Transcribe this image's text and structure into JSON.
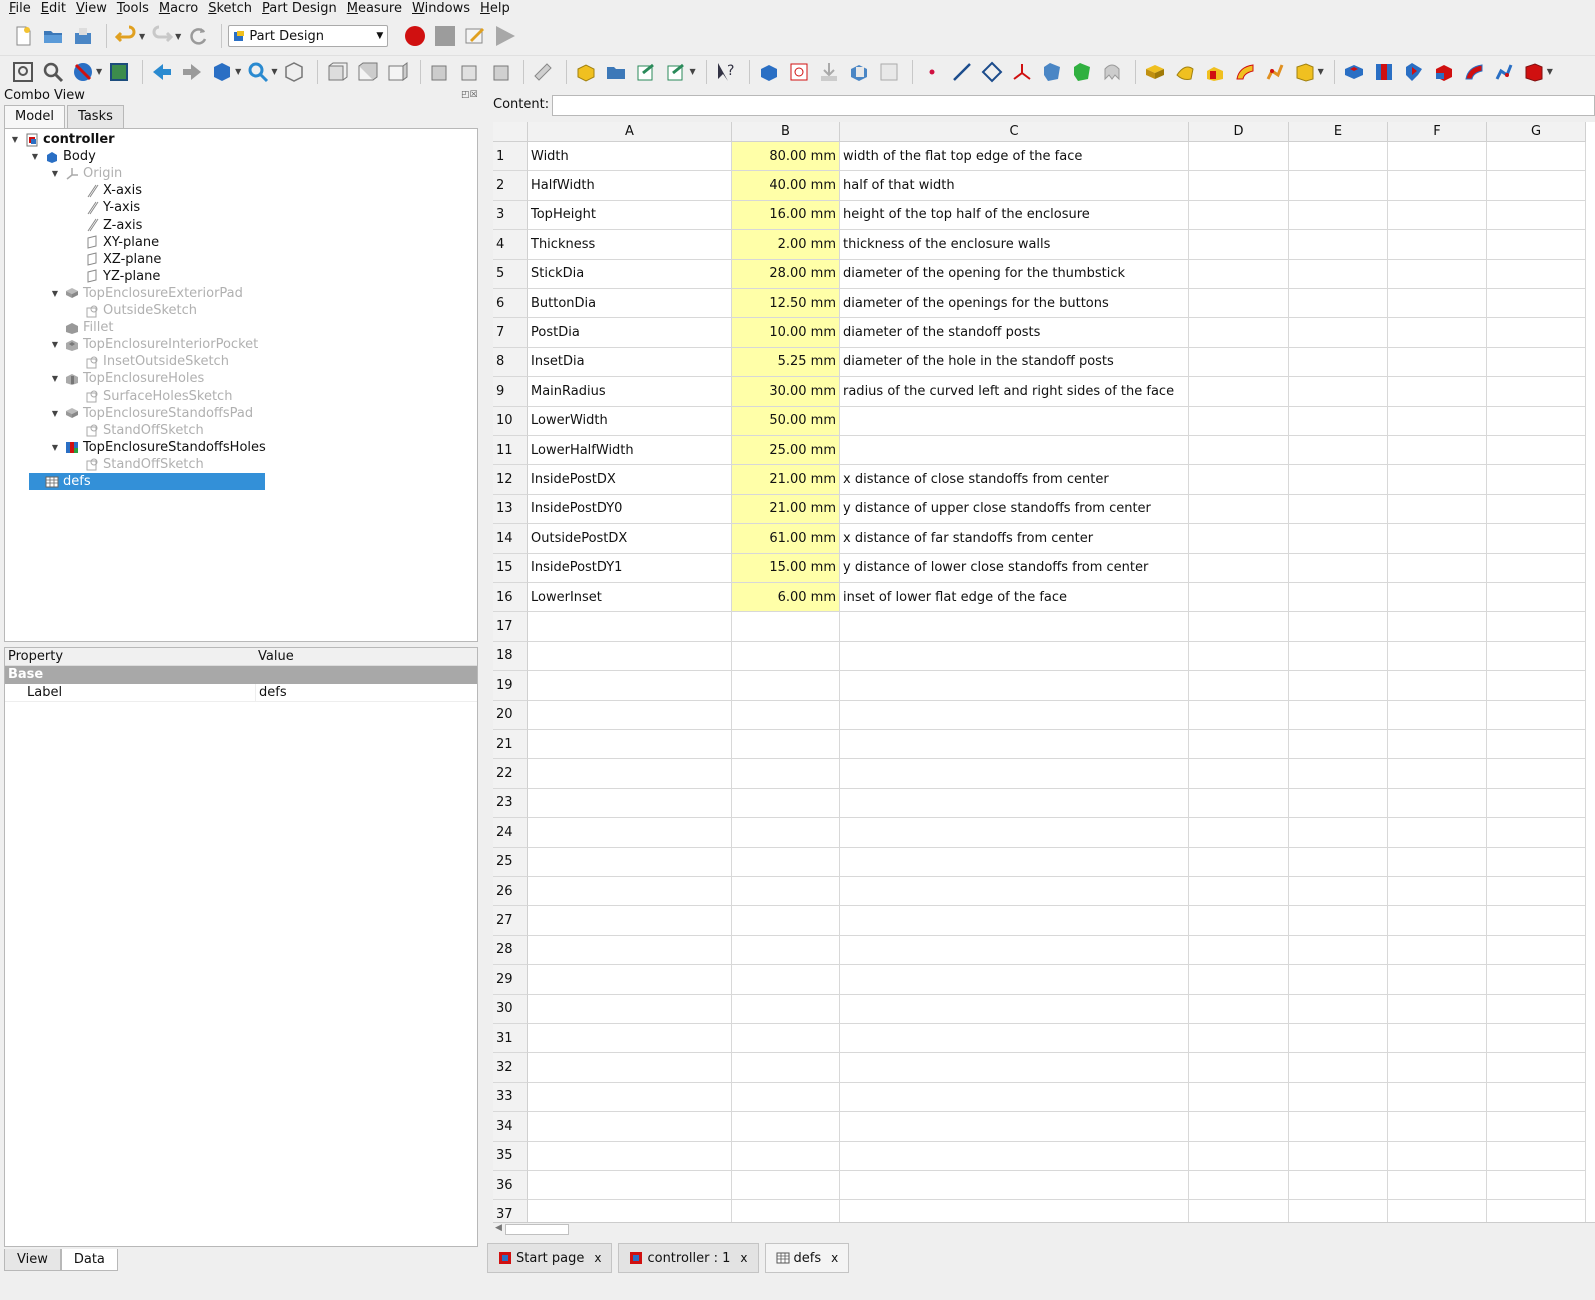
{
  "menu": [
    "File",
    "Edit",
    "View",
    "Tools",
    "Macro",
    "Sketch",
    "Part Design",
    "Measure",
    "Windows",
    "Help"
  ],
  "workbench": "Part Design",
  "combo": {
    "title": "Combo View",
    "tabs": [
      "Model",
      "Tasks"
    ]
  },
  "tree": [
    {
      "label": "controller",
      "level": 0,
      "exp": "▼",
      "style": "bold",
      "icon": "document-icon"
    },
    {
      "label": "Body",
      "level": 1,
      "exp": "▼",
      "style": "",
      "icon": "body-icon"
    },
    {
      "label": "Origin",
      "level": 2,
      "exp": "▼",
      "style": "dim",
      "icon": "origin-icon"
    },
    {
      "label": "X-axis",
      "level": 3,
      "exp": "",
      "style": "",
      "icon": "axis-icon"
    },
    {
      "label": "Y-axis",
      "level": 3,
      "exp": "",
      "style": "",
      "icon": "axis-icon"
    },
    {
      "label": "Z-axis",
      "level": 3,
      "exp": "",
      "style": "",
      "icon": "axis-icon"
    },
    {
      "label": "XY-plane",
      "level": 3,
      "exp": "",
      "style": "",
      "icon": "plane-icon"
    },
    {
      "label": "XZ-plane",
      "level": 3,
      "exp": "",
      "style": "",
      "icon": "plane-icon"
    },
    {
      "label": "YZ-plane",
      "level": 3,
      "exp": "",
      "style": "",
      "icon": "plane-icon"
    },
    {
      "label": "TopEnclosureExteriorPad",
      "level": 2,
      "exp": "▼",
      "style": "dim",
      "icon": "pad-icon"
    },
    {
      "label": "OutsideSketch",
      "level": 3,
      "exp": "",
      "style": "dim",
      "icon": "sketch-icon"
    },
    {
      "label": "Fillet",
      "level": 2,
      "exp": "",
      "style": "dim",
      "icon": "fillet-icon"
    },
    {
      "label": "TopEnclosureInteriorPocket",
      "level": 2,
      "exp": "▼",
      "style": "dim",
      "icon": "pocket-icon"
    },
    {
      "label": "InsetOutsideSketch",
      "level": 3,
      "exp": "",
      "style": "dim",
      "icon": "sketch-icon"
    },
    {
      "label": "TopEnclosureHoles",
      "level": 2,
      "exp": "▼",
      "style": "dim",
      "icon": "hole-icon"
    },
    {
      "label": "SurfaceHolesSketch",
      "level": 3,
      "exp": "",
      "style": "dim",
      "icon": "sketch-icon"
    },
    {
      "label": "TopEnclosureStandoffsPad",
      "level": 2,
      "exp": "▼",
      "style": "dim",
      "icon": "pad-icon"
    },
    {
      "label": "StandOffSketch",
      "level": 3,
      "exp": "",
      "style": "dim",
      "icon": "sketch-icon"
    },
    {
      "label": "TopEnclosureStandoffsHoles",
      "level": 2,
      "exp": "▼",
      "style": "",
      "icon": "hole-active-icon"
    },
    {
      "label": "StandOffSketch",
      "level": 3,
      "exp": "",
      "style": "dim",
      "icon": "sketch-icon"
    },
    {
      "label": "defs",
      "level": 1,
      "exp": "",
      "style": "selected",
      "icon": "spreadsheet-icon"
    }
  ],
  "properties": {
    "headers": [
      "Property",
      "Value"
    ],
    "group": "Base",
    "rows": [
      {
        "name": "Label",
        "value": "defs"
      }
    ]
  },
  "bottom_tabs": [
    "View",
    "Data"
  ],
  "content_label": "Content:",
  "columns": [
    "A",
    "B",
    "C",
    "D",
    "E",
    "F",
    "G"
  ],
  "rows": [
    [
      "Width",
      "80.00 mm",
      "width of the flat top edge of the face"
    ],
    [
      "HalfWidth",
      "40.00 mm",
      "half of that width"
    ],
    [
      "TopHeight",
      "16.00 mm",
      "height of the top half of the enclosure"
    ],
    [
      "Thickness",
      "2.00 mm",
      "thickness of the enclosure walls"
    ],
    [
      "StickDia",
      "28.00 mm",
      "diameter of the opening for the thumbstick"
    ],
    [
      "ButtonDia",
      "12.50 mm",
      "diameter of the openings for the buttons"
    ],
    [
      "PostDia",
      "10.00 mm",
      "diameter of the standoff posts"
    ],
    [
      "InsetDia",
      "5.25 mm",
      "diameter of the hole in the standoff posts"
    ],
    [
      "MainRadius",
      "30.00 mm",
      "radius of the curved left and right sides of the face"
    ],
    [
      "LowerWidth",
      "50.00 mm",
      ""
    ],
    [
      "LowerHalfWidth",
      "25.00 mm",
      ""
    ],
    [
      "InsidePostDX",
      "21.00 mm",
      "x distance of close standoffs from center"
    ],
    [
      "InsidePostDY0",
      "21.00 mm",
      "y distance of upper close standoffs from center"
    ],
    [
      "OutsidePostDX",
      "61.00 mm",
      "x distance of far standoffs from center"
    ],
    [
      "InsidePostDY1",
      "15.00 mm",
      "y distance of lower close standoffs from center"
    ],
    [
      "LowerInset",
      "6.00 mm",
      "inset of lower flat edge of the face"
    ]
  ],
  "row_numbers": [
    "1",
    "2",
    "3",
    "4",
    "5",
    "6",
    "7",
    "8",
    "9",
    "10",
    "11",
    "12",
    "13",
    "14",
    "15",
    "16",
    "17",
    "18",
    "19",
    "20",
    "21",
    "22",
    "23",
    "24",
    "25",
    "26",
    "27",
    "28",
    "29",
    "30",
    "31",
    "32",
    "33",
    "34",
    "35",
    "36",
    "37"
  ],
  "doc_tabs": [
    {
      "label": "Start page",
      "close": "x"
    },
    {
      "label": "controller : 1",
      "close": "x"
    },
    {
      "label": "defs",
      "close": "x"
    }
  ],
  "colors": {
    "selection": "#3390d8",
    "cell_highlight": "#ffffa8",
    "record": "#d01010"
  }
}
